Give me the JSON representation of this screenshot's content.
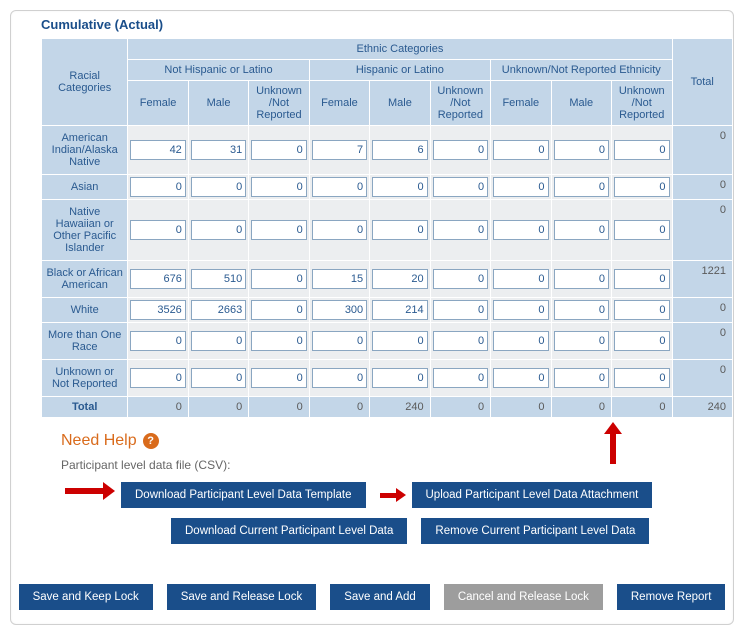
{
  "title": "Cumulative (Actual)",
  "table": {
    "ethnic_header": "Ethnic Categories",
    "groups": [
      "Not Hispanic or Latino",
      "Hispanic or Latino",
      "Unknown/Not Reported Ethnicity"
    ],
    "total_label": "Total",
    "racial_label": "Racial Categories",
    "sub_cols": [
      "Female",
      "Male",
      "Unknown /Not Reported"
    ],
    "rows": [
      {
        "label": "American Indian/Alaska Native",
        "v": [
          42,
          31,
          0,
          7,
          6,
          0,
          0,
          0,
          0
        ],
        "total": 0
      },
      {
        "label": "Asian",
        "v": [
          0,
          0,
          0,
          0,
          0,
          0,
          0,
          0,
          0
        ],
        "total": 0
      },
      {
        "label": "Native Hawaiian or Other Pacific Islander",
        "v": [
          0,
          0,
          0,
          0,
          0,
          0,
          0,
          0,
          0
        ],
        "total": 0
      },
      {
        "label": "Black or African American",
        "v": [
          676,
          510,
          0,
          15,
          20,
          0,
          0,
          0,
          0
        ],
        "total": 1221
      },
      {
        "label": "White",
        "v": [
          3526,
          2663,
          0,
          300,
          214,
          0,
          0,
          0,
          0
        ],
        "total": 0
      },
      {
        "label": "More than One Race",
        "v": [
          0,
          0,
          0,
          0,
          0,
          0,
          0,
          0,
          0
        ],
        "total": 0
      },
      {
        "label": "Unknown or Not Reported",
        "v": [
          0,
          0,
          0,
          0,
          0,
          0,
          0,
          0,
          0
        ],
        "total": 0
      }
    ],
    "totals": {
      "label": "Total",
      "v": [
        0,
        0,
        0,
        0,
        240,
        0,
        0,
        0,
        0
      ],
      "grand": 240
    }
  },
  "help": {
    "need_help": "Need Help",
    "file_label": "Participant level data file (CSV):"
  },
  "file_buttons": {
    "download_template": "Download Participant Level Data Template",
    "upload": "Upload Participant Level Data Attachment",
    "download_current": "Download Current Participant Level Data",
    "remove_current": "Remove Current Participant Level Data"
  },
  "bottom_buttons": {
    "save_keep": "Save and Keep Lock",
    "save_release": "Save and Release Lock",
    "save_add": "Save and Add",
    "cancel_release": "Cancel and Release Lock",
    "remove_report": "Remove Report"
  }
}
